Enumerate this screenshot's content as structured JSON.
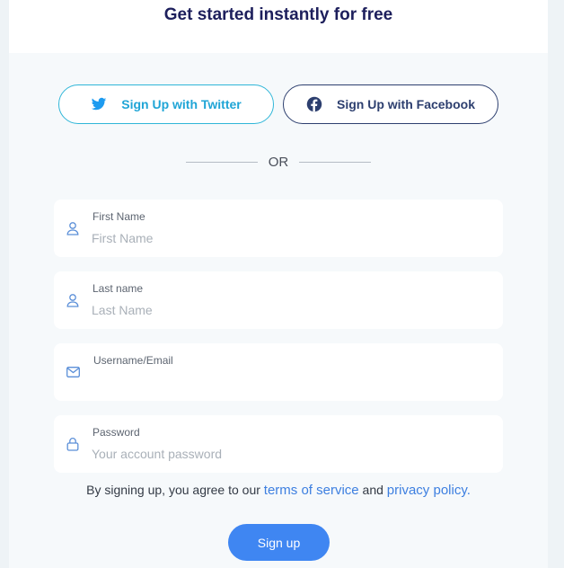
{
  "header": {
    "title": "Get started instantly for free"
  },
  "social": {
    "twitter_label": "Sign Up with Twitter",
    "facebook_label": "Sign Up with Facebook"
  },
  "divider": {
    "text": "OR"
  },
  "fields": {
    "first_name": {
      "label": "First Name",
      "placeholder": "First Name",
      "icon": "user-icon"
    },
    "last_name": {
      "label": "Last name",
      "placeholder": "Last Name",
      "icon": "user-icon"
    },
    "email": {
      "label": "Username/Email",
      "placeholder": "",
      "icon": "mail-icon"
    },
    "password": {
      "label": "Password",
      "placeholder": "Your account password",
      "icon": "lock-icon"
    }
  },
  "terms": {
    "prefix": "By signing up, you agree to our ",
    "tos_link": "terms of service",
    "middle": " and ",
    "privacy_link": "privacy policy."
  },
  "submit": {
    "label": "Sign up"
  },
  "colors": {
    "title": "#1d1f5c",
    "twitter": "#1fa5d6",
    "facebook": "#2d3f6f",
    "link": "#3d7fe0",
    "primary_button": "#3f86f2",
    "field_icon": "#5b8fd8"
  }
}
